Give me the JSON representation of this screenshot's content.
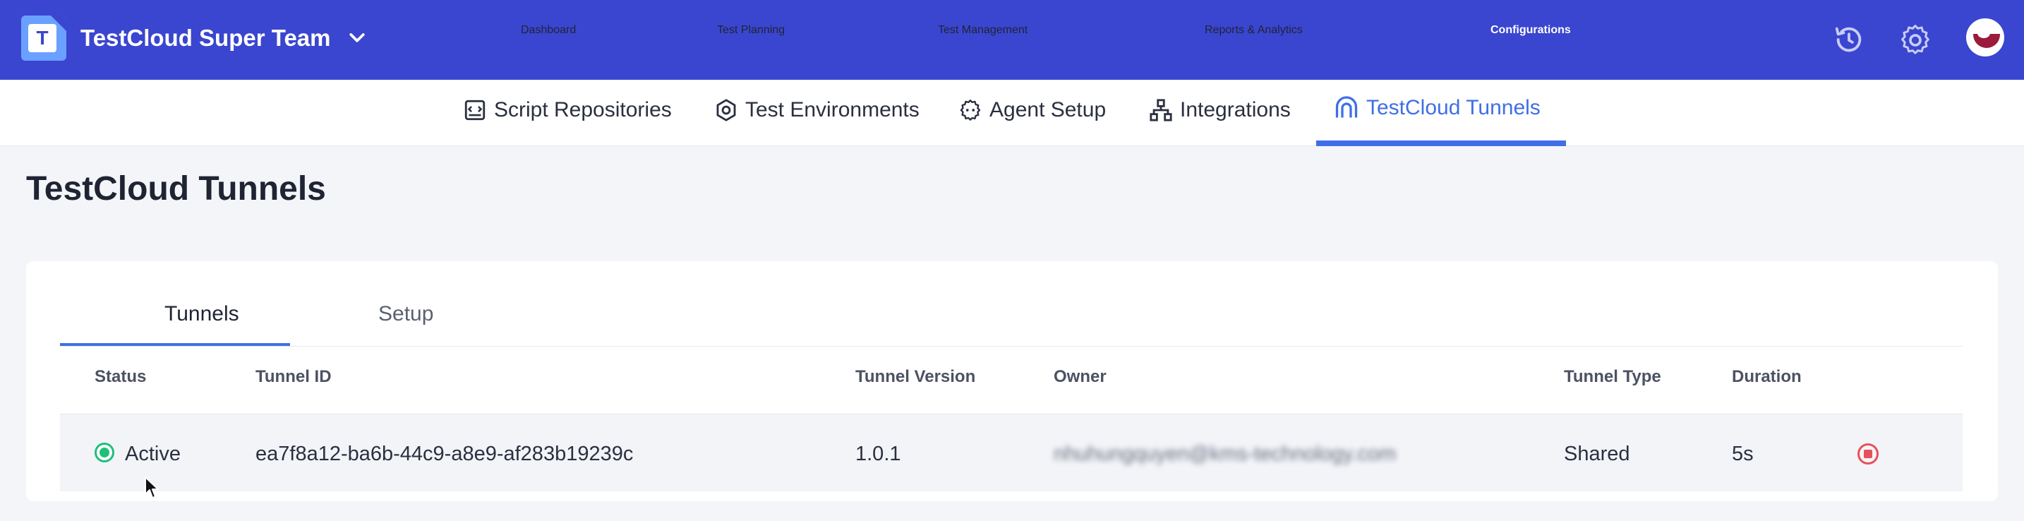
{
  "header": {
    "team_name": "TestCloud Super Team",
    "logo_letter": "T",
    "nav": [
      {
        "label": "Dashboard"
      },
      {
        "label": "Test Planning"
      },
      {
        "label": "Test Management"
      },
      {
        "label": "Reports & Analytics"
      },
      {
        "label": "Configurations",
        "active": true
      }
    ],
    "icons": [
      "history-icon",
      "gear-icon",
      "avatar"
    ]
  },
  "subnav": {
    "items": [
      {
        "label": "Script Repositories",
        "icon": "script-repo-icon"
      },
      {
        "label": "Test Environments",
        "icon": "environment-icon"
      },
      {
        "label": "Agent Setup",
        "icon": "agent-icon"
      },
      {
        "label": "Integrations",
        "icon": "integrations-icon"
      },
      {
        "label": "TestCloud Tunnels",
        "icon": "tunnel-icon",
        "active": true
      }
    ]
  },
  "page": {
    "title": "TestCloud Tunnels"
  },
  "tabs": [
    {
      "label": "Tunnels",
      "active": true
    },
    {
      "label": "Setup"
    }
  ],
  "table": {
    "columns": [
      "Status",
      "Tunnel ID",
      "Tunnel Version",
      "Owner",
      "Tunnel Type",
      "Duration"
    ],
    "rows": [
      {
        "status": "Active",
        "tunnel_id": "ea7f8a12-ba6b-44c9-a8e9-af283b19239c",
        "version": "1.0.1",
        "owner": "nhuhungquyen@kms-technology.com",
        "type": "Shared",
        "duration": "5s"
      }
    ]
  },
  "colors": {
    "topbar": "#3a46d0",
    "accent": "#3f6ee8",
    "status_active": "#1fbf7a",
    "stop": "#e5525b"
  }
}
